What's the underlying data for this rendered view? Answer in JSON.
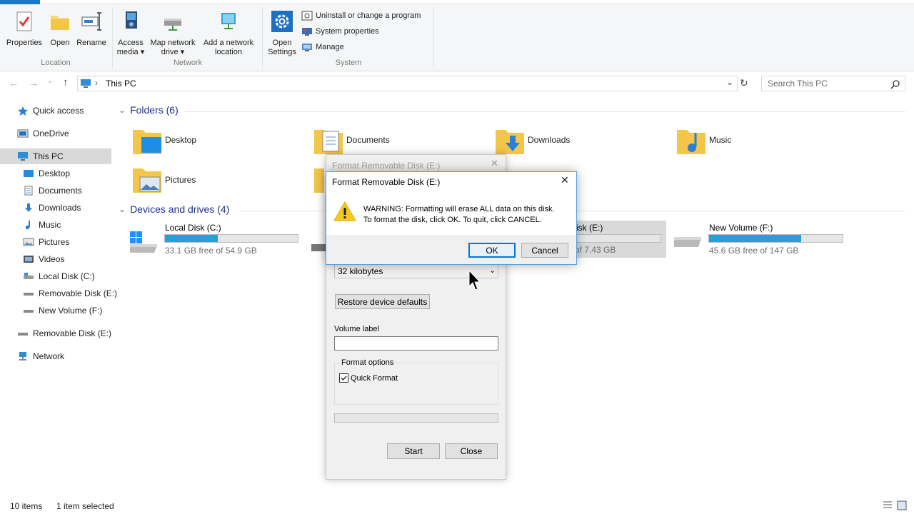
{
  "ribbon": {
    "groups": [
      {
        "label": "Location",
        "buttons": [
          "Properties",
          "Open",
          "Rename"
        ]
      },
      {
        "label": "Network",
        "buttons": [
          "Access media",
          "Map network drive",
          "Add a network location"
        ]
      },
      {
        "label": "System",
        "open_settings": "Open Settings",
        "small_buttons": [
          "Uninstall or change a program",
          "System properties",
          "Manage"
        ]
      }
    ],
    "access_line1": "Access",
    "access_line2": "media ▾",
    "map_line1": "Map network",
    "map_line2": "drive ▾",
    "addnet_line1": "Add a network",
    "addnet_line2": "location",
    "open_line1": "Open",
    "open_line2": "Settings"
  },
  "nav": {
    "breadcrumb": "This PC",
    "separator": "›",
    "search_placeholder": "Search This PC"
  },
  "sidebar": {
    "items": [
      {
        "label": "Quick access",
        "icon": "star-icon"
      },
      {
        "label": "OneDrive",
        "icon": "onedrive-icon"
      },
      {
        "label": "This PC",
        "icon": "pc-icon",
        "selected": true
      },
      {
        "label": "Desktop",
        "icon": "desktop-icon"
      },
      {
        "label": "Documents",
        "icon": "documents-icon"
      },
      {
        "label": "Downloads",
        "icon": "downloads-icon"
      },
      {
        "label": "Music",
        "icon": "music-icon"
      },
      {
        "label": "Pictures",
        "icon": "pictures-icon"
      },
      {
        "label": "Videos",
        "icon": "videos-icon"
      },
      {
        "label": "Local Disk (C:)",
        "icon": "drive-icon"
      },
      {
        "label": "Removable Disk (E:)",
        "icon": "removable-drive-icon"
      },
      {
        "label": "New Volume (F:)",
        "icon": "drive-icon"
      },
      {
        "label": "Removable Disk (E:)",
        "icon": "removable-drive-icon"
      },
      {
        "label": "Network",
        "icon": "network-icon"
      }
    ]
  },
  "content": {
    "folders_header": "Folders (6)",
    "folders": [
      "Desktop",
      "Documents",
      "Downloads",
      "Music",
      "Pictures"
    ],
    "devices_header": "Devices and drives (4)",
    "drives": [
      {
        "name": "Local Disk (C:)",
        "free": "33.1 GB free of 54.9 GB",
        "used_fraction": 0.4
      },
      {
        "name": "isk (E:)",
        "free": "of 7.43 GB"
      },
      {
        "name": "New Volume (F:)",
        "free": "45.6 GB free of 147 GB",
        "used_fraction": 0.69
      }
    ]
  },
  "status": {
    "items": "10 items",
    "selected": "1 item selected"
  },
  "format_dialog": {
    "title": "Format Removable Disk (E:)",
    "allocation_value": "32 kilobytes",
    "restore_button": "Restore device defaults",
    "volume_label": "Volume label",
    "format_options": "Format options",
    "quick_format": "Quick Format",
    "start_button": "Start",
    "close_button": "Close"
  },
  "warning_dialog": {
    "title": "Format Removable Disk (E:)",
    "line1": "WARNING: Formatting will erase ALL data on this disk.",
    "line2": "To format the disk, click OK. To quit, click CANCEL.",
    "ok": "OK",
    "cancel": "Cancel"
  },
  "colors": {
    "accent": "#26a0da",
    "header_blue": "#1e3287",
    "selected_bg": "#d9d9d9"
  }
}
